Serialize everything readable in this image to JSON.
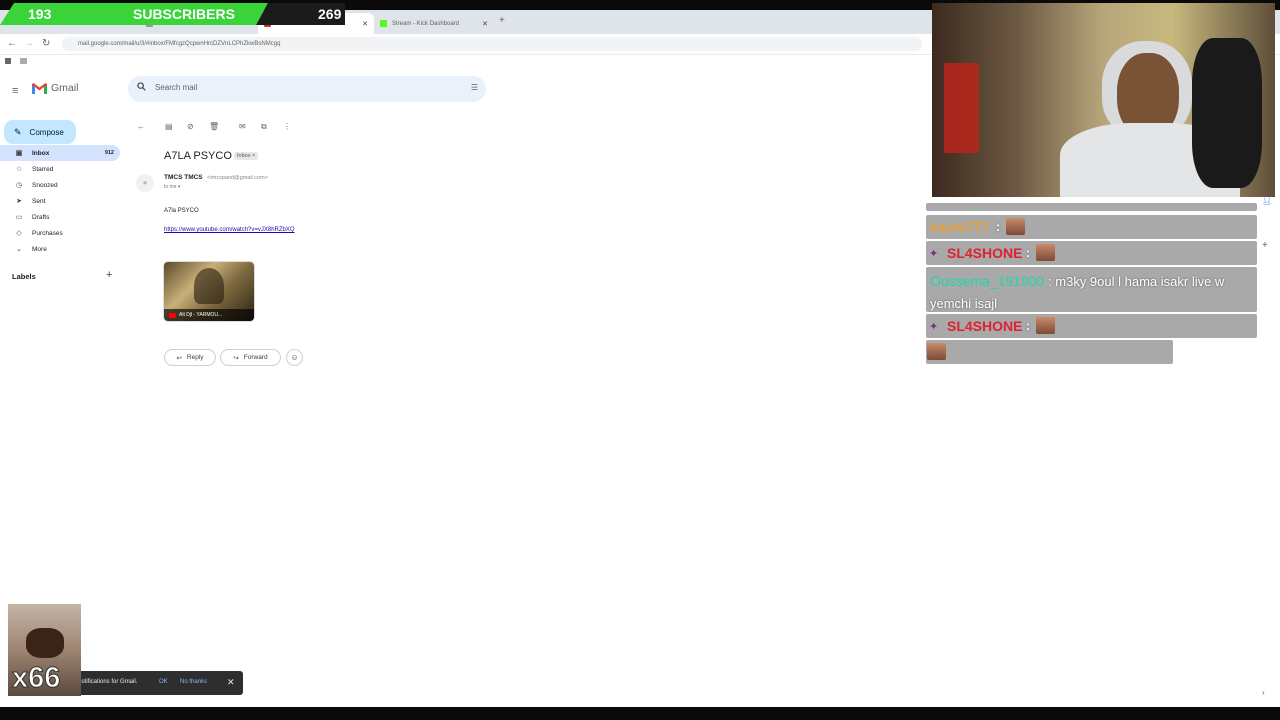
{
  "browser": {
    "tabs": [
      {
        "label": "",
        "active": false
      },
      {
        "label": "",
        "active": true
      },
      {
        "label": "Stream - Kick Dashboard",
        "active": false
      }
    ],
    "url": "mail.google.com/mail/u/3/#inbox/FMfcgzQcpwnHrcDZVnLCPhZkwBsNMcgq"
  },
  "overlay": {
    "sub_count": "193",
    "sub_label": "SUBSCRIBERS",
    "sub_goal": "269",
    "combo_count": "x66"
  },
  "gmail": {
    "brand": "Gmail",
    "search_placeholder": "Search mail",
    "compose_label": "Compose",
    "nav": [
      {
        "label": "Inbox",
        "count": "912",
        "icon": "inbox-icon"
      },
      {
        "label": "Starred",
        "count": "",
        "icon": "star-icon"
      },
      {
        "label": "Snoozed",
        "count": "",
        "icon": "clock-icon"
      },
      {
        "label": "Sent",
        "count": "",
        "icon": "send-icon"
      },
      {
        "label": "Drafts",
        "count": "",
        "icon": "draft-icon"
      },
      {
        "label": "Purchases",
        "count": "",
        "icon": "tag-icon"
      },
      {
        "label": "More",
        "count": "",
        "icon": "chevron-down-icon"
      }
    ],
    "labels_heading": "Labels",
    "email": {
      "subject": "A7LA PSYCO",
      "label_chip": "Inbox ×",
      "sender_name": "TMCS TMCS",
      "sender_email": "<tmcspand@gmail.com>",
      "to_line": "to me ▾",
      "body_text": "A7la PSYCO",
      "body_link": "https://www.youtube.com/watch?v=vJX8hRZbXQ",
      "attachment_caption": "Alt Djl - YARMOU..."
    },
    "actions": {
      "reply": "Reply",
      "forward": "Forward"
    },
    "snackbar": {
      "text": "notifications for Gmail.",
      "ok": "OK",
      "no_thanks": "No thanks"
    }
  },
  "chat": {
    "messages": [
      {
        "user": "kashi777",
        "color": "#e8a13a",
        "text": ""
      },
      {
        "user": "SL4SHONE",
        "color": "#e0212f",
        "text": ""
      },
      {
        "user": "Oussema_191900",
        "color": "#1fd6a8",
        "text": "m3ky 9oul l hama isakr live w yemchi isajl"
      },
      {
        "user": "SL4SHONE",
        "color": "#e0212f",
        "text": ""
      }
    ]
  },
  "colors": {
    "sub_green": "#3ad33a",
    "compose_bg": "#c2e7ff",
    "link": "#1a0dab"
  }
}
